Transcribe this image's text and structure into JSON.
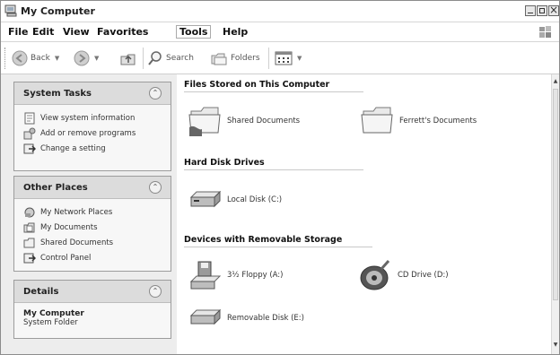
{
  "window": {
    "title": "My Computer"
  },
  "menu": [
    "File",
    "Edit",
    "View",
    "Favorites",
    "Tools",
    "Help"
  ],
  "toolbar": {
    "back": "Back",
    "search": "Search",
    "folders": "Folders"
  },
  "left_pane": {
    "system_tasks": {
      "title": "System Tasks",
      "items": [
        "View system information",
        "Add or remove programs",
        "Change a setting"
      ]
    },
    "other_places": {
      "title": "Other Places",
      "items": [
        "My Network Places",
        "My Documents",
        "Shared Documents",
        "Control Panel"
      ]
    },
    "details": {
      "title": "Details",
      "name": "My Computer",
      "type": "System Folder"
    }
  },
  "content": {
    "files_section": {
      "title": "Files Stored on This Computer",
      "items": [
        "Shared Documents",
        "Ferrett's Documents"
      ]
    },
    "hdd_section": {
      "title": "Hard Disk Drives",
      "items": [
        "Local Disk (C:)"
      ]
    },
    "removable_section": {
      "title": "Devices with Removable Storage",
      "items": [
        "3½ Floppy (A:)",
        "CD Drive (D:)",
        "Removable Disk (E:)"
      ]
    }
  }
}
